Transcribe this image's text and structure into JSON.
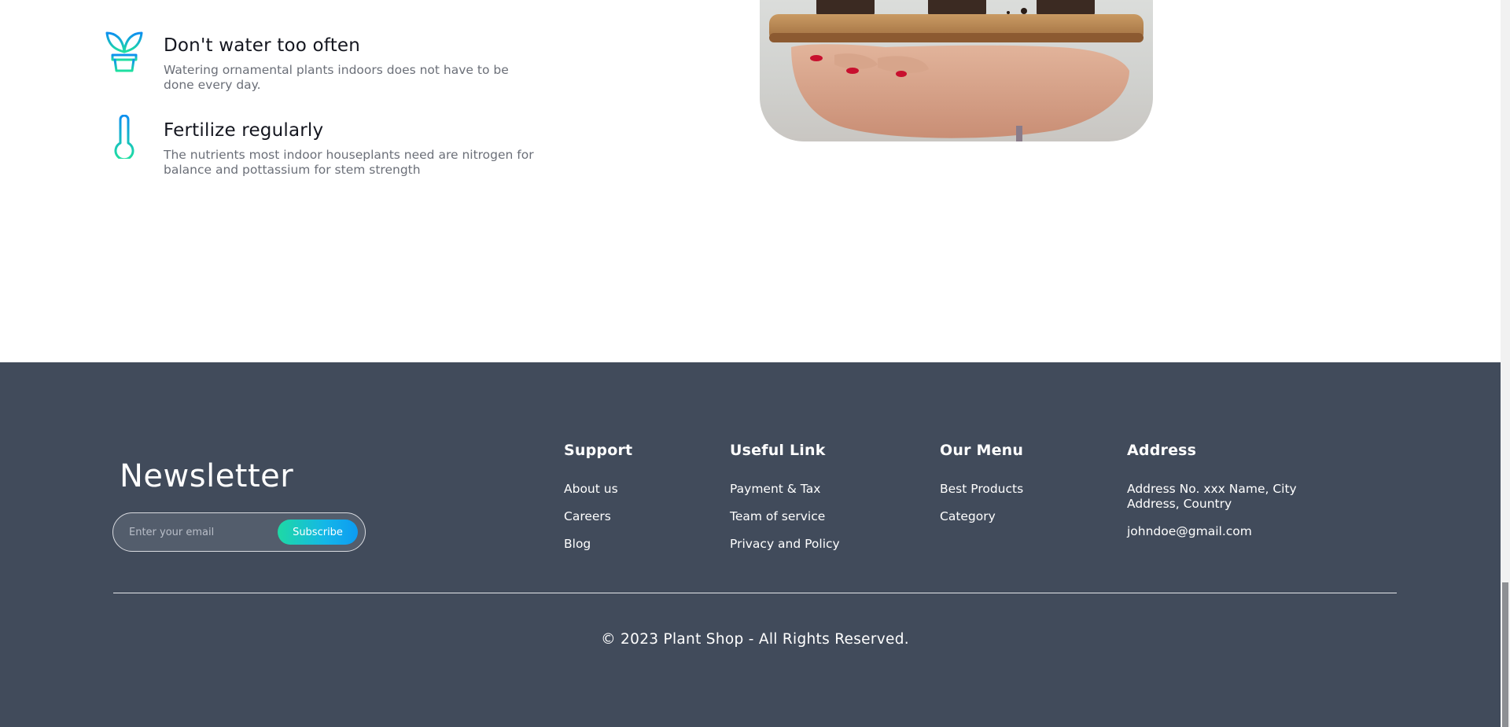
{
  "tips": [
    {
      "icon": "plant-pot-icon",
      "title": "Don't water too often",
      "description": "Watering ornamental plants indoors does not have to be done every day."
    },
    {
      "icon": "thermometer-icon",
      "title": "Fertilize regularly",
      "description": "The nutrients most indoor houseplants need are nitrogen for balance and pottassium for stem strength"
    }
  ],
  "footer": {
    "newsletter": {
      "title": "Newsletter",
      "placeholder": "Enter your email",
      "button": "Subscribe"
    },
    "support": {
      "title": "Support",
      "links": [
        "About us",
        "Careers",
        "Blog"
      ]
    },
    "useful": {
      "title": "Useful Link",
      "links": [
        "Payment & Tax",
        "Team of service",
        "Privacy and Policy"
      ]
    },
    "menu": {
      "title": "Our Menu",
      "links": [
        "Best Products",
        "Category"
      ]
    },
    "address": {
      "title": "Address",
      "line1": "Address No. xxx Name, City",
      "line2": "Address, Country",
      "email": "johndoe@gmail.com"
    },
    "copyright": "© 2023 Plant Shop - All Rights Reserved."
  },
  "colors": {
    "footer_bg": "#414b5b",
    "accent_start": "#1ed9a5",
    "accent_end": "#0d9bf2"
  }
}
